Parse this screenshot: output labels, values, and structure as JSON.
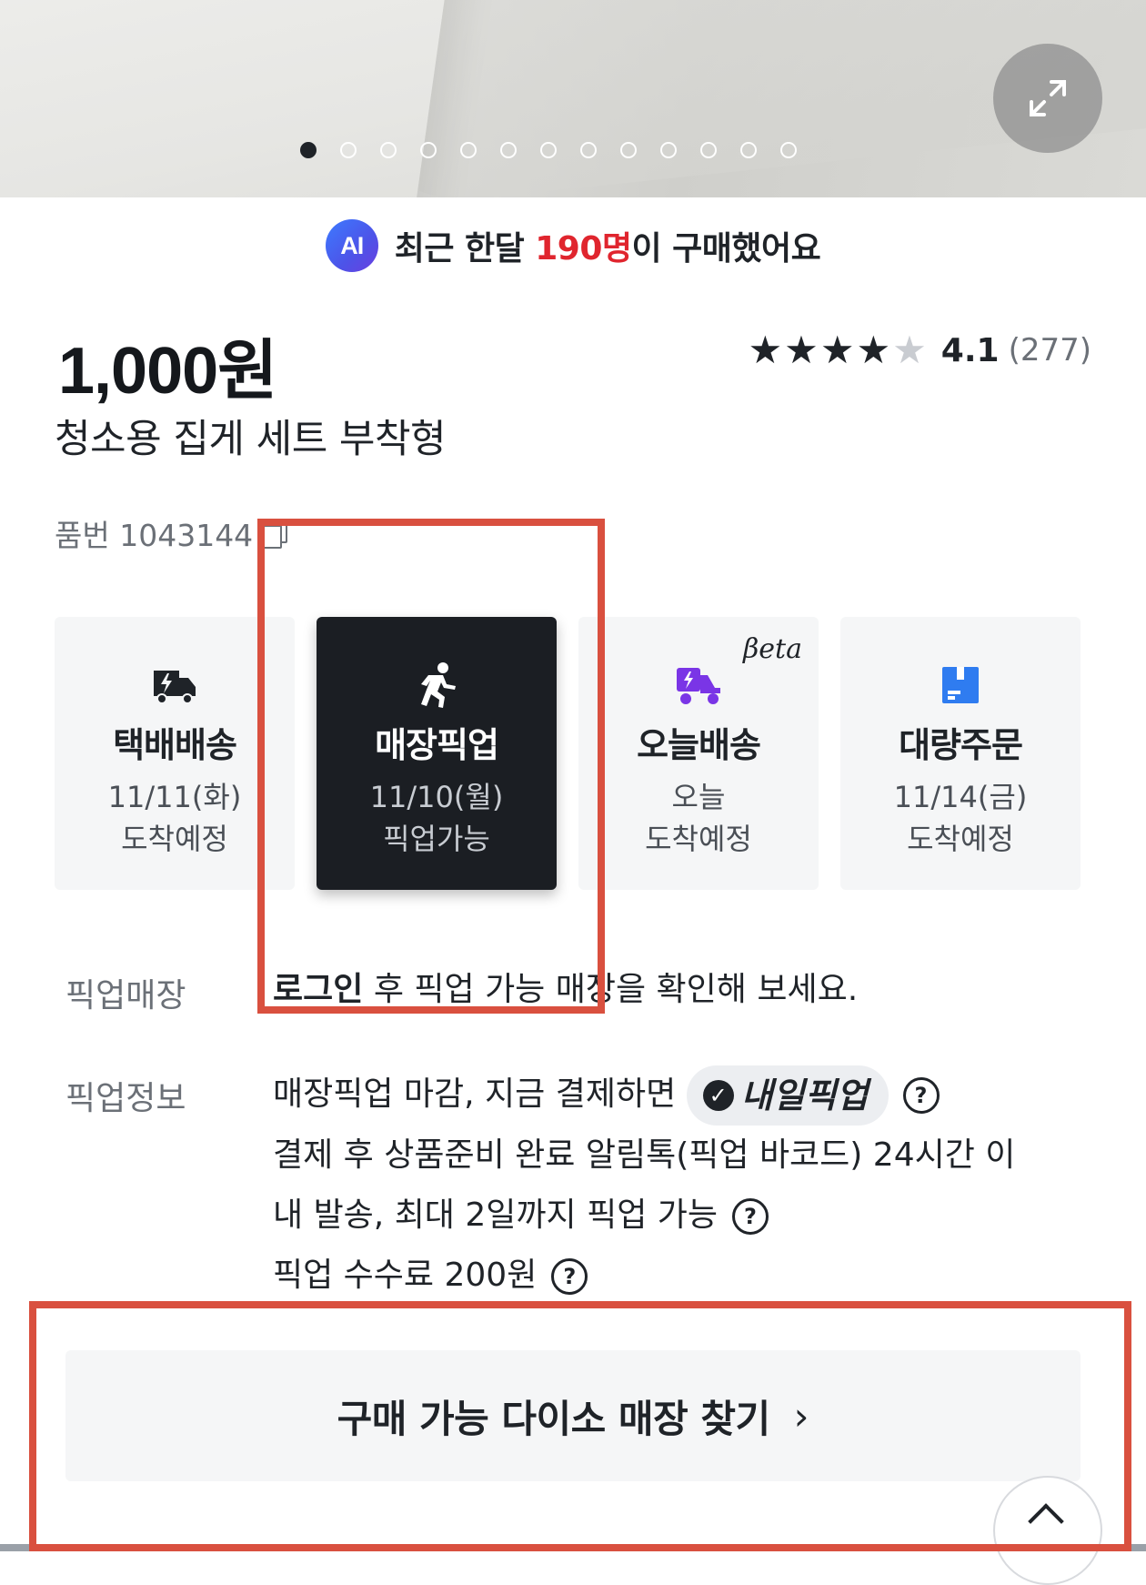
{
  "hero": {
    "dots_total": 13,
    "active_dot": 1
  },
  "ai_banner": {
    "badge": "AI",
    "text_before": "최근 한달 ",
    "highlight": "190명",
    "text_after": "이 구매했어요",
    "highlight_color": "#e0252e"
  },
  "product": {
    "price": "1,000원",
    "name": "청소용 집게 세트 부착형",
    "sku": "품번 1043144"
  },
  "rating": {
    "value": "4.1",
    "count": "(277)",
    "stars_filled": 4,
    "stars_total": 5
  },
  "delivery_options": [
    {
      "title": "택배배송",
      "line1": "11/11(화)",
      "line2": "도착예정",
      "icon": "truck-icon",
      "selected": false
    },
    {
      "title": "매장픽업",
      "line1": "11/10(월)",
      "line2": "픽업가능",
      "icon": "running-person-icon",
      "selected": true
    },
    {
      "title": "오늘배송",
      "line1": "오늘",
      "line2": "도착예정",
      "icon": "delivery-scooter-icon",
      "selected": false,
      "badge": "βeta"
    },
    {
      "title": "대량주문",
      "line1": "11/14(금)",
      "line2": "도착예정",
      "icon": "box-icon",
      "selected": false
    }
  ],
  "pickup_store": {
    "label": "픽업매장",
    "link": "로그인",
    "text": " 후 픽업 가능 매장을 확인해 보세요."
  },
  "pickup_info": {
    "label": "픽업정보",
    "line1": "매장픽업 마감, 지금 결제하면",
    "badge": "내일픽업",
    "line2": "결제 후 상품준비 완료 알림톡(픽업 바코드) 24시간 이",
    "line3": "내 발송, 최대 2일까지 픽업 가능",
    "line4": "픽업 수수료 200원",
    "help": "?"
  },
  "find_store": {
    "label": "구매 가능 다이소 매장 찾기",
    "chevron": "›"
  },
  "annotation_color": "#d9503f"
}
